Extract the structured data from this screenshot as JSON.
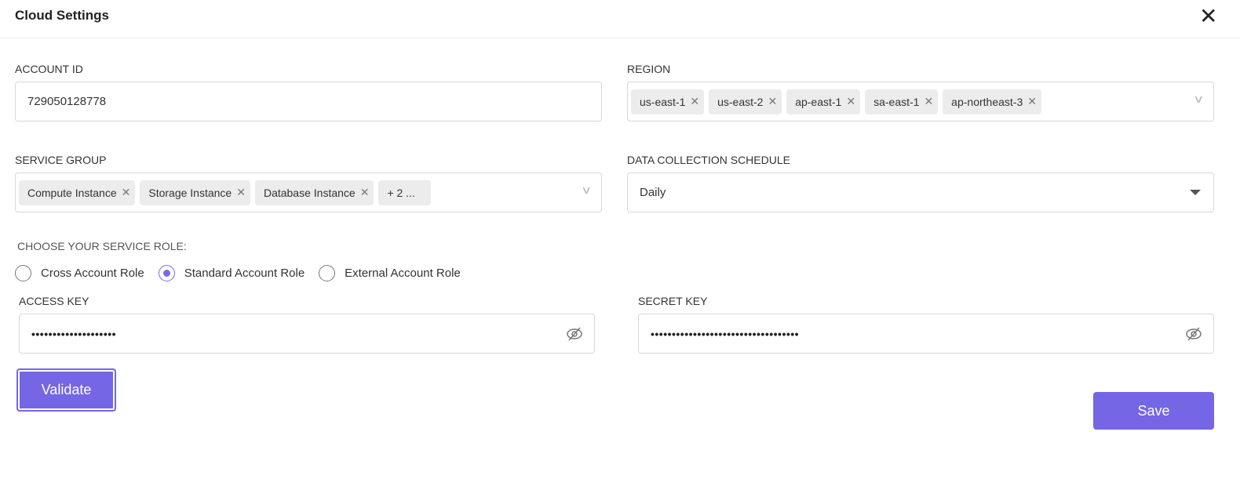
{
  "header": {
    "title": "Cloud Settings",
    "close_icon": "close-icon"
  },
  "account_id": {
    "label": "ACCOUNT ID",
    "value": "729050128778"
  },
  "region": {
    "label": "REGION",
    "chips": [
      "us-east-1",
      "us-east-2",
      "ap-east-1",
      "sa-east-1",
      "ap-northeast-3"
    ]
  },
  "service_group": {
    "label": "SERVICE GROUP",
    "chips": [
      "Compute Instance",
      "Storage Instance",
      "Database Instance"
    ],
    "more": "+ 2 ..."
  },
  "schedule": {
    "label": "DATA COLLECTION SCHEDULE",
    "value": "Daily"
  },
  "service_role": {
    "label": "CHOOSE YOUR SERVICE ROLE:",
    "options": [
      "Cross Account Role",
      "Standard Account Role",
      "External Account Role"
    ],
    "selected": "Standard Account Role"
  },
  "access_key": {
    "label": "ACCESS KEY",
    "value": "••••••••••••••••••••"
  },
  "secret_key": {
    "label": "SECRET KEY",
    "value": "•••••••••••••••••••••••••••••••••••"
  },
  "buttons": {
    "validate": "Validate",
    "save": "Save"
  },
  "colors": {
    "accent": "#7466e4"
  }
}
